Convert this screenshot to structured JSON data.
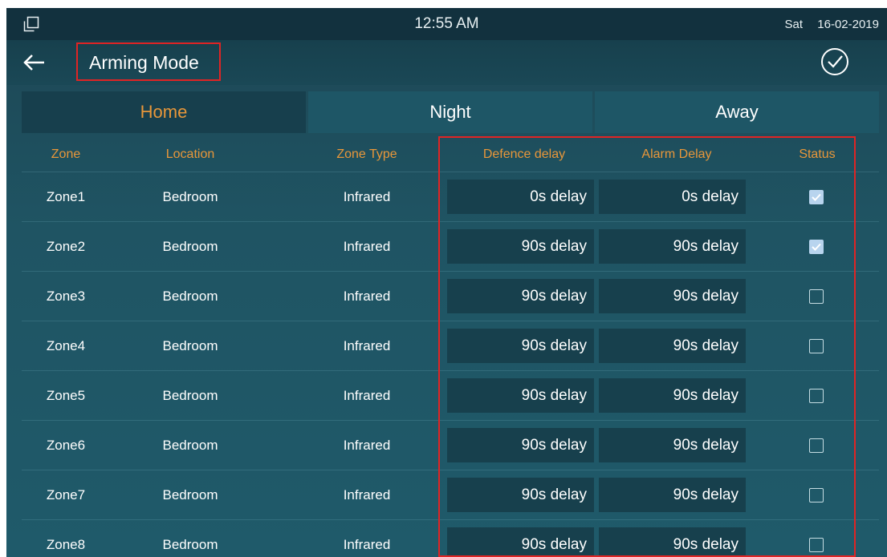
{
  "status_bar": {
    "time": "12:55 AM",
    "day": "Sat",
    "date": "16-02-2019"
  },
  "header": {
    "title": "Arming Mode",
    "back_icon": "arrow-left-icon",
    "confirm_icon": "check-circle-icon"
  },
  "tabs": [
    {
      "label": "Home",
      "active": true
    },
    {
      "label": "Night",
      "active": false
    },
    {
      "label": "Away",
      "active": false
    }
  ],
  "table": {
    "columns": [
      "Zone",
      "Location",
      "Zone Type",
      "Defence delay",
      "Alarm Delay",
      "Status"
    ],
    "rows": [
      {
        "zone": "Zone1",
        "location": "Bedroom",
        "type": "Infrared",
        "defence": "0s delay",
        "alarm": "0s delay",
        "status": true
      },
      {
        "zone": "Zone2",
        "location": "Bedroom",
        "type": "Infrared",
        "defence": "90s delay",
        "alarm": "90s delay",
        "status": true
      },
      {
        "zone": "Zone3",
        "location": "Bedroom",
        "type": "Infrared",
        "defence": "90s delay",
        "alarm": "90s delay",
        "status": false
      },
      {
        "zone": "Zone4",
        "location": "Bedroom",
        "type": "Infrared",
        "defence": "90s delay",
        "alarm": "90s delay",
        "status": false
      },
      {
        "zone": "Zone5",
        "location": "Bedroom",
        "type": "Infrared",
        "defence": "90s delay",
        "alarm": "90s delay",
        "status": false
      },
      {
        "zone": "Zone6",
        "location": "Bedroom",
        "type": "Infrared",
        "defence": "90s delay",
        "alarm": "90s delay",
        "status": false
      },
      {
        "zone": "Zone7",
        "location": "Bedroom",
        "type": "Infrared",
        "defence": "90s delay",
        "alarm": "90s delay",
        "status": false
      },
      {
        "zone": "Zone8",
        "location": "Bedroom",
        "type": "Infrared",
        "defence": "90s delay",
        "alarm": "90s delay",
        "status": false
      }
    ]
  },
  "colors": {
    "accent_orange": "#e8973a",
    "highlight_red": "#e02424",
    "checked_fill": "#b8d4ee"
  }
}
